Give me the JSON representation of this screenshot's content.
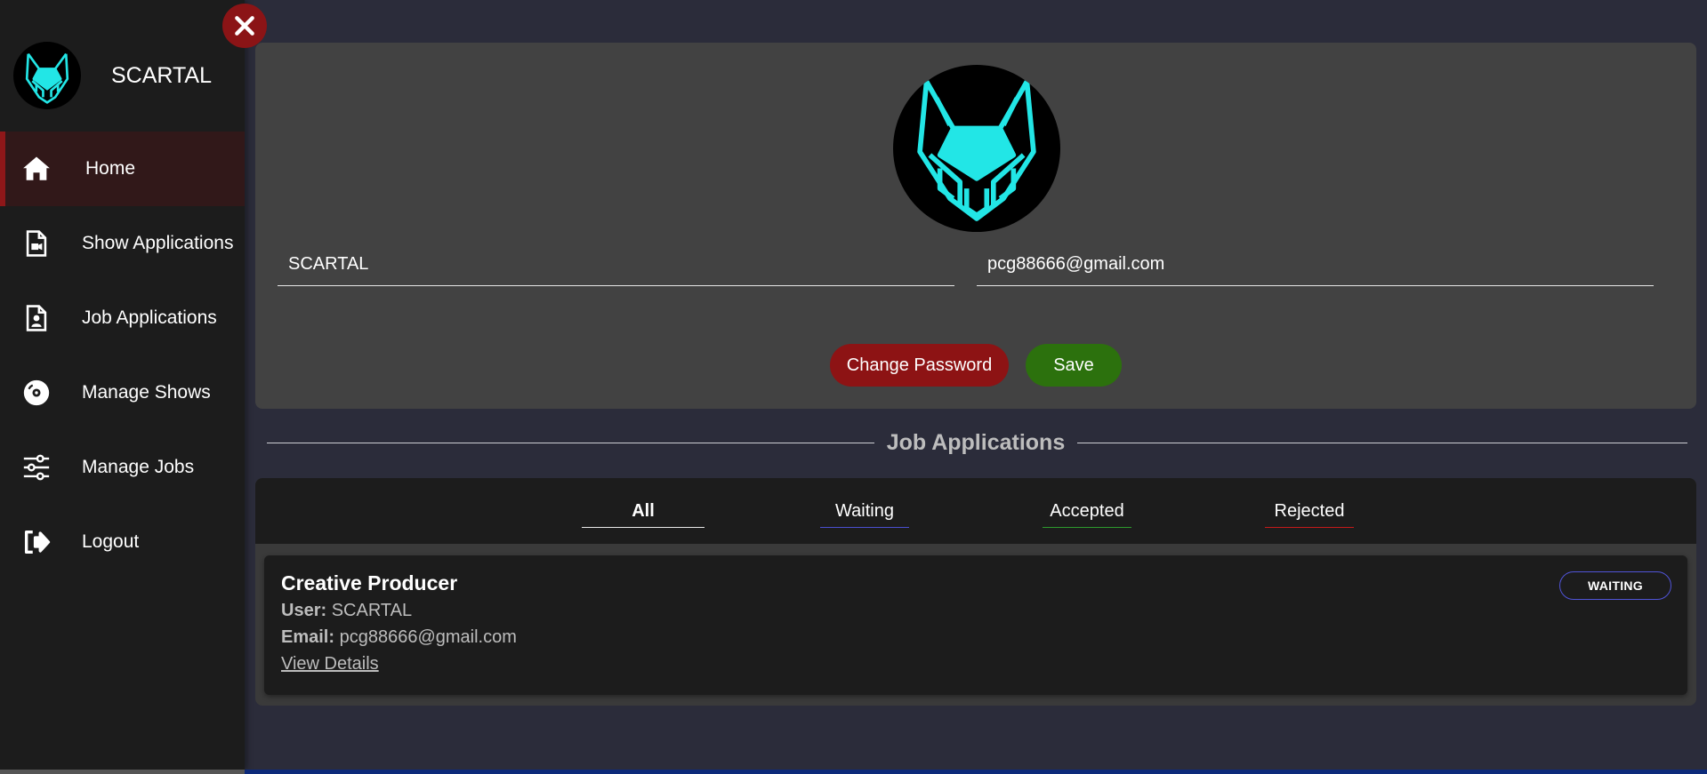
{
  "sidebar": {
    "brand_name": "SCARTAL",
    "items": [
      {
        "label": "Home",
        "icon": "home-icon",
        "active": true
      },
      {
        "label": "Show Applications",
        "icon": "file-video-icon",
        "active": false
      },
      {
        "label": "Job Applications",
        "icon": "file-user-icon",
        "active": false
      },
      {
        "label": "Manage Shows",
        "icon": "disc-icon",
        "active": false
      },
      {
        "label": "Manage Jobs",
        "icon": "sliders-icon",
        "active": false
      },
      {
        "label": "Logout",
        "icon": "logout-icon",
        "active": false
      }
    ],
    "close_icon": "close-icon"
  },
  "profile": {
    "name_value": "SCARTAL",
    "email_value": "pcg88666@gmail.com",
    "change_password_label": "Change Password",
    "save_label": "Save"
  },
  "job_applications": {
    "section_title": "Job Applications",
    "tabs": [
      {
        "label": "All",
        "color": "#e8e8e8"
      },
      {
        "label": "Waiting",
        "color": "#4a4fd0"
      },
      {
        "label": "Accepted",
        "color": "#2e9a2e"
      },
      {
        "label": "Rejected",
        "color": "#c41a1a"
      }
    ],
    "items": [
      {
        "title": "Creative Producer",
        "user_label": "User:",
        "user_value": "SCARTAL",
        "email_label": "Email:",
        "email_value": "pcg88666@gmail.com",
        "link_label": "View Details",
        "status": "WAITING"
      }
    ]
  },
  "colors": {
    "accent_red": "#8d1314",
    "accent_green": "#2c710d",
    "logo_cyan": "#22e6e6",
    "background": "#2b2c3a"
  }
}
